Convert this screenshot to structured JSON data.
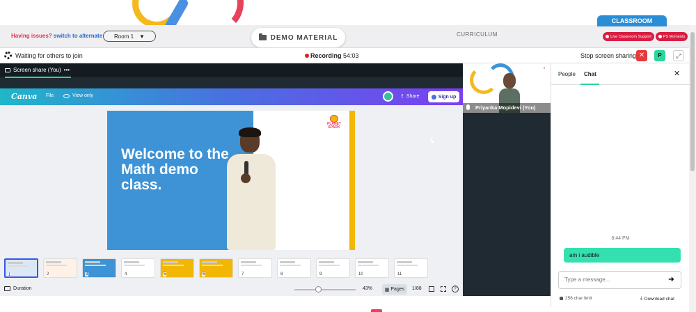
{
  "header": {
    "issues_text": "Having issues?",
    "alternate_room_link": "switch to alternate room",
    "room_select": "Room 1",
    "demo_material_button": "DEMO MATERIAL",
    "curriculum_label": "CURRICULUM",
    "classroom_tab": "CLASSROOM",
    "live_support_button": "Live Classroom Support",
    "ps_moments_button": "PS Moments"
  },
  "meeting_bar": {
    "waiting_text": "Waiting for others to join",
    "recording_label": "Recording",
    "recording_time": "54:03",
    "stop_sharing": "Stop screen sharing",
    "avatar_initial": "P"
  },
  "screen_share": {
    "label": "Screen share (You)",
    "more": "•••"
  },
  "canva": {
    "logo": "Canva",
    "file_menu": "File",
    "view_only": "View only",
    "share_button": "Share",
    "signup_button": "Sign up",
    "slide_title": "Welcome to the Math demo class.",
    "slide_logo_line1": "PLANET",
    "slide_logo_line2": "SPARK",
    "thumbnails": [
      {
        "num": "1",
        "color": "#dbe7f5"
      },
      {
        "num": "2",
        "color": "#fdf1e8"
      },
      {
        "num": "3",
        "color": "#3d93d5"
      },
      {
        "num": "4",
        "color": "#ffffff"
      },
      {
        "num": "5",
        "color": "#f2b705"
      },
      {
        "num": "6",
        "color": "#f2b705"
      },
      {
        "num": "7",
        "color": "#ffffff"
      },
      {
        "num": "8",
        "color": "#ffffff"
      },
      {
        "num": "9",
        "color": "#ffffff"
      },
      {
        "num": "10",
        "color": "#ffffff"
      },
      {
        "num": "11",
        "color": "#ffffff"
      }
    ],
    "duration_label": "Duration",
    "zoom": "43%",
    "zoom_level": 0.43,
    "pages_button": "Pages",
    "page_count": "1/88",
    "help": "?"
  },
  "video": {
    "participant_name": "Priyanka Mopidevi (You)"
  },
  "chat": {
    "tab_people": "People",
    "tab_chat": "Chat",
    "close": "✕",
    "message_time": "8:44 PM",
    "message_text": "am i audible",
    "input_placeholder": "Type a message...",
    "send": "➜",
    "char_limit": "256 char limit",
    "download_chat": "Download chat"
  },
  "colors": {
    "accent_green": "#2bd69a",
    "record_red": "#e02020",
    "support_red": "#d81e43",
    "classroom_blue": "#2a8ed6"
  }
}
